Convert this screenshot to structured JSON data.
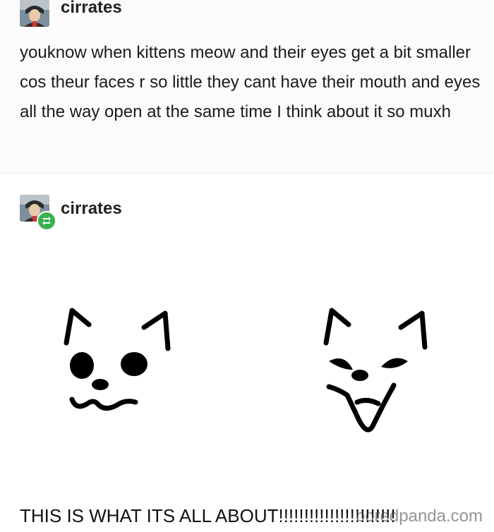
{
  "original_post": {
    "username": "cirrates",
    "text": "youknow when kittens meow and their eyes get a bit smaller cos theur faces r so little they cant have their mouth and eyes all the way open at the same time I think about it so muxh"
  },
  "reblog": {
    "username": "cirrates",
    "badge_icon": "reblog-icon",
    "badge_color": "#37b24d",
    "caption": "THIS IS WHAT ITS ALL ABOUT!!!!!!!!!!!!!!!!!!!!!!!"
  },
  "watermark": {
    "text": "boredpanda.com"
  }
}
